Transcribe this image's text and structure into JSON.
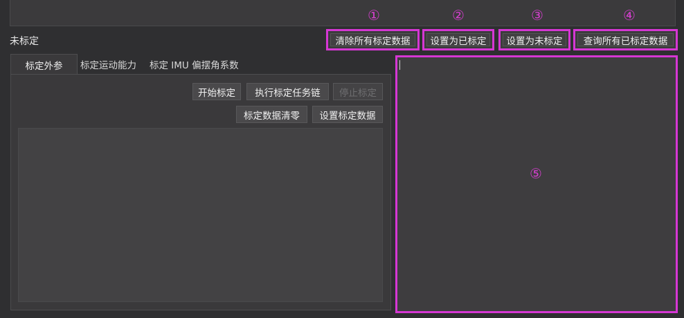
{
  "status": "未标定",
  "annotations": [
    "①",
    "②",
    "③",
    "④",
    "⑤"
  ],
  "actions": {
    "clear_all": "清除所有标定数据",
    "set_calibrated": "设置为已标定",
    "set_uncalibrated": "设置为未标定",
    "query_all": "查询所有已标定数据"
  },
  "tabs": [
    "标定外参",
    "标定运动能力",
    "标定 IMU 偏摆角系数"
  ],
  "panel": {
    "start": "开始标定",
    "run_chain": "执行标定任务链",
    "stop": "停止标定",
    "reset_data": "标定数据清零",
    "set_data": "设置标定数据"
  },
  "colors": {
    "highlight": "#d637d4",
    "background": "#2f2f31"
  }
}
